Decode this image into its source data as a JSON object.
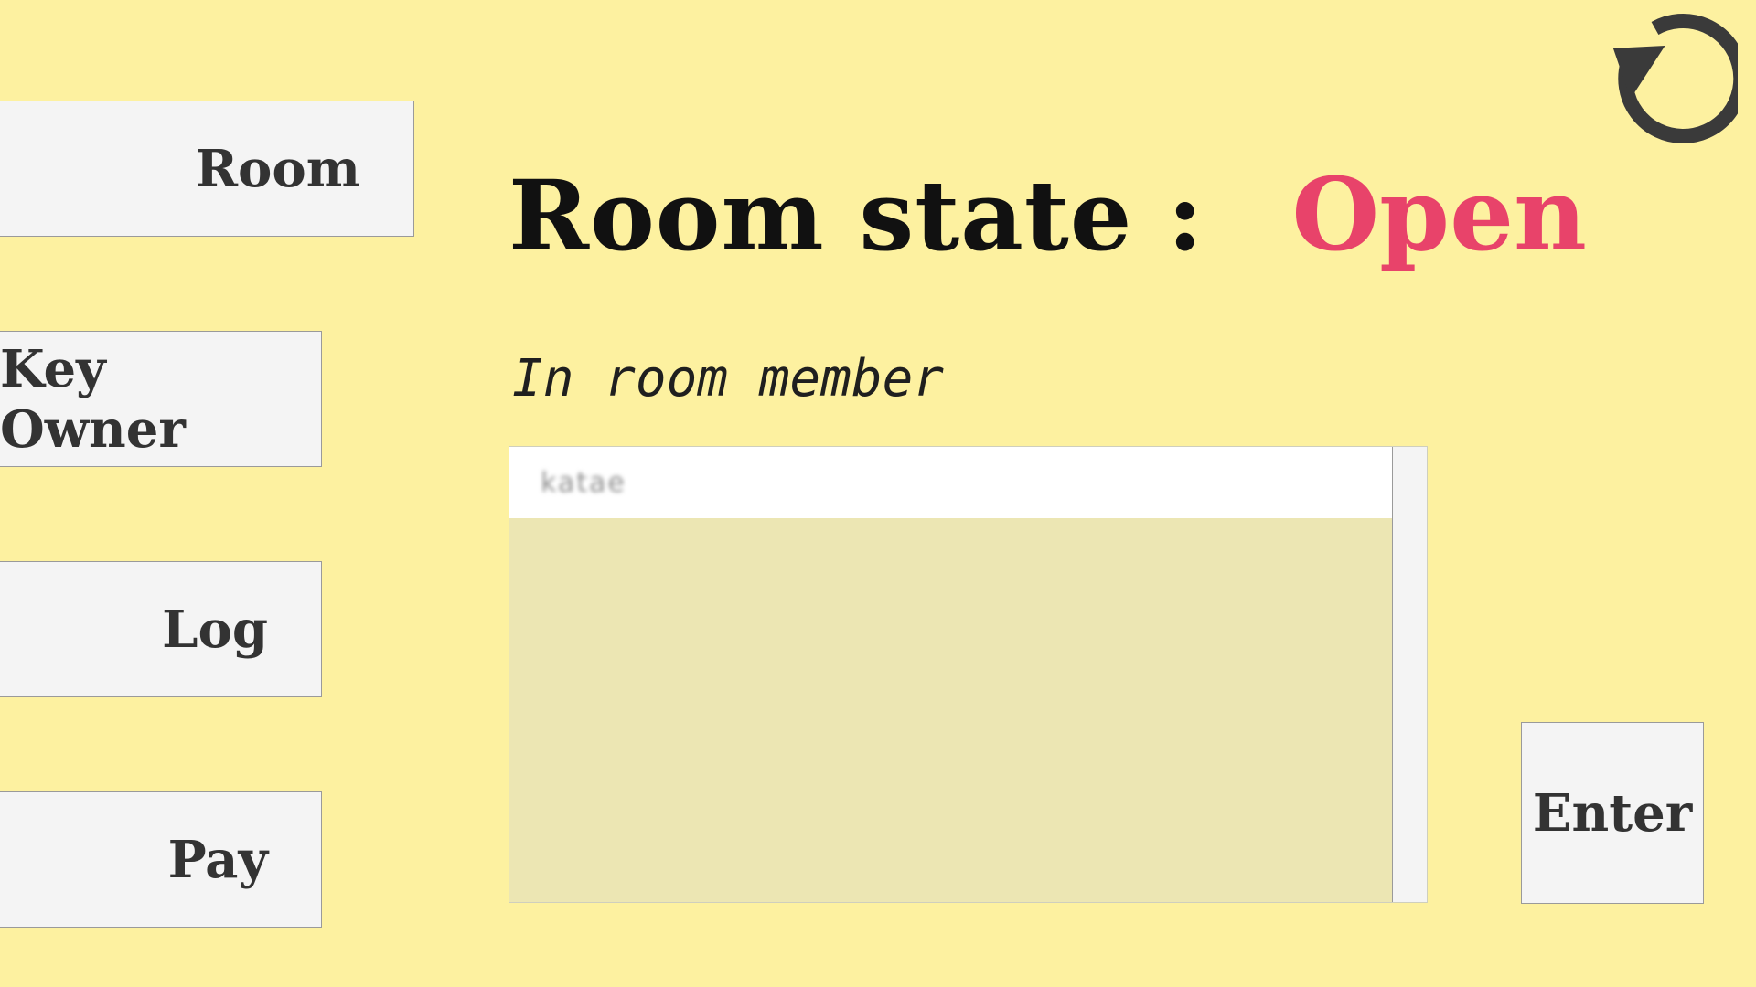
{
  "nav": {
    "room_label": "Room",
    "key_owner_label": "Key Owner",
    "log_label": "Log",
    "pay_label": "Pay"
  },
  "status": {
    "label": "Room state :",
    "value": "Open",
    "value_color": "#E8436A"
  },
  "members": {
    "title": "In room member",
    "items": [
      "katae"
    ]
  },
  "actions": {
    "enter_label": "Enter"
  },
  "icons": {
    "refresh": "refresh-icon"
  },
  "colors": {
    "background": "#FDF1A0",
    "button": "#F4F4F4",
    "list_background": "#ECE6B3"
  }
}
